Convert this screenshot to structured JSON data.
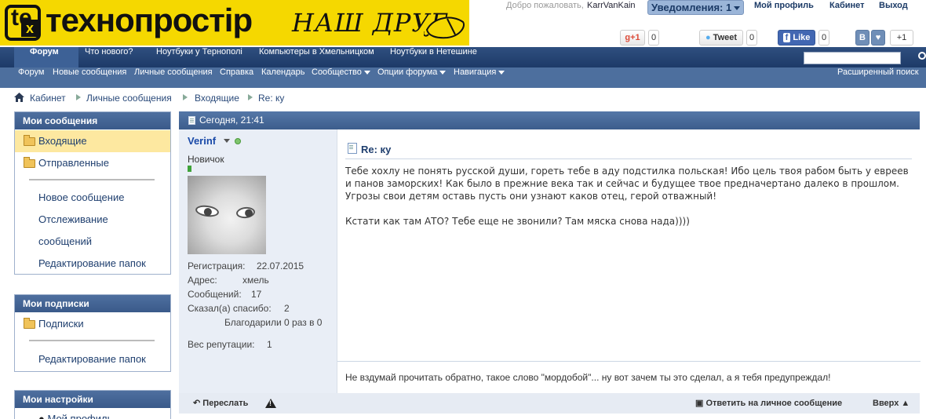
{
  "header": {
    "logo_text": "технопростір",
    "logo_mark_letters": [
      "te",
      "x"
    ],
    "slogan": "НАШ ДРУГ",
    "welcome": "Добро пожаловать,",
    "username": "KarrVanKain",
    "notifications_label": "Уведомления: 1",
    "links": [
      "Мой профиль",
      "Кабинет",
      "Выход"
    ],
    "social": {
      "gplus_label": "+1",
      "gplus_count": "0",
      "tweet_label": "Tweet",
      "tweet_count": "0",
      "fb_label": "Like",
      "fb_count": "0",
      "vk_label": "В",
      "vk_count": "+1"
    }
  },
  "nav_main": [
    "Форум",
    "Что нового?",
    "Ноутбуки у Тернополі",
    "Компьютеры в Хмельницком",
    "Ноутбуки в Нетешине"
  ],
  "nav_sub": [
    "Форум",
    "Новые сообщения",
    "Личные сообщения",
    "Справка",
    "Календарь",
    "Сообщество",
    "Опции форума",
    "Навигация"
  ],
  "nav_sub_right": "Расширенный поиск",
  "breadcrumb": [
    "Кабинет",
    "Личные сообщения",
    "Входящие",
    "Re: ку"
  ],
  "sidebar": {
    "messages_title": "Мои сообщения",
    "inbox": "Входящие",
    "sent": "Отправленные",
    "new_message": "Новое сообщение",
    "tracking_1": "Отслеживание",
    "tracking_2": "сообщений",
    "edit_folders": "Редактирование папок",
    "subs_title": "Мои подписки",
    "subscriptions": "Подписки",
    "subs_edit_folders": "Редактирование папок",
    "settings_title": "Мои настройки",
    "my_profile": "Мой профиль"
  },
  "message": {
    "date": "Сегодня, 21:41",
    "author": "Verinf",
    "rank": "Новичок",
    "info": {
      "reg_label": "Регистрация:",
      "reg_value": "22.07.2015",
      "addr_label": "Адрес:",
      "addr_value": "хмель",
      "posts_label": "Сообщений:",
      "posts_value": "17",
      "thanks_label": "Сказал(а) спасибо:",
      "thanks_value": "2",
      "thanked": "Благодарили 0 раз в 0",
      "rep_label": "Вес репутации:",
      "rep_value": "1"
    },
    "title": "Re: ку",
    "body_1": "Тебе хохлу не понять русской души, гореть тебе в аду подстилка польская! Ибо цель твоя рабом быть у евреев и панов заморских! Как было в прежние века так и сейчас и будущее твое предначертано далеко в прошлом. Угрозы свои детям оставь пусть они узнают каков отец, герой отважный!",
    "body_2": "Кстати как там АТО? Тебе еще не звонили? Там мяска снова нада))))",
    "signature": "Не вздумай прочитать обратно, такое слово \"мордобой\"... ну вот зачем ты это сделал, а я тебя предупреждал!",
    "forward": "Переслать",
    "reply": "Ответить на личное сообщение",
    "top": "Вверх ▲"
  }
}
